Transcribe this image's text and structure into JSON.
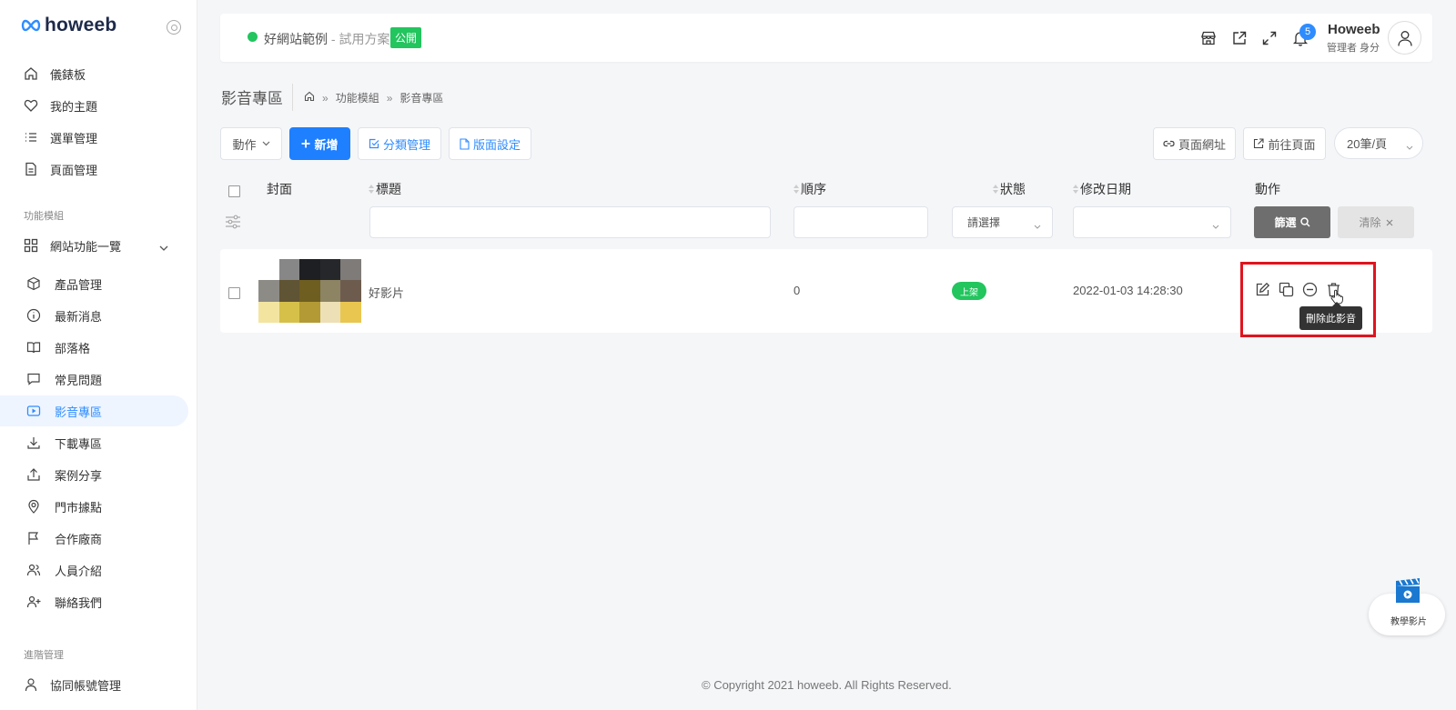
{
  "brand": {
    "name": "howeeb"
  },
  "sidebar": {
    "items": [
      {
        "label": "儀錶板",
        "icon": "home-icon"
      },
      {
        "label": "我的主題",
        "icon": "heart-icon"
      },
      {
        "label": "選單管理",
        "icon": "list-icon"
      },
      {
        "label": "頁面管理",
        "icon": "file-icon"
      }
    ],
    "section_modules": "功能模組",
    "group_label": "網站功能一覽",
    "modules": [
      {
        "label": "產品管理",
        "icon": "box-icon"
      },
      {
        "label": "最新消息",
        "icon": "info-icon"
      },
      {
        "label": "部落格",
        "icon": "book-icon"
      },
      {
        "label": "常見問題",
        "icon": "message-icon"
      },
      {
        "label": "影音專區",
        "icon": "video-icon"
      },
      {
        "label": "下載專區",
        "icon": "download-icon"
      },
      {
        "label": "案例分享",
        "icon": "share-icon"
      },
      {
        "label": "門市據點",
        "icon": "map-pin-icon"
      },
      {
        "label": "合作廠商",
        "icon": "flag-icon"
      },
      {
        "label": "人員介紹",
        "icon": "users-icon"
      },
      {
        "label": "聯絡我們",
        "icon": "user-plus-icon"
      }
    ],
    "section_admin": "進階管理",
    "admin_items": [
      {
        "label": "協同帳號管理",
        "icon": "user-icon"
      }
    ]
  },
  "topbar": {
    "site_name": "好網站範例",
    "site_plan": " - 試用方案",
    "site_badge": "公開",
    "notification_count": "5",
    "user_name": "Howeeb",
    "user_role": "管理者 身分"
  },
  "page": {
    "title": "影音專區",
    "breadcrumb": [
      "功能模組",
      "影音專區"
    ]
  },
  "toolbar": {
    "action_label": "動作",
    "add_label": "新增",
    "category_label": "分類管理",
    "layout_label": "版面設定",
    "page_url_label": "頁面網址",
    "goto_page_label": "前往頁面",
    "per_page": "20筆/頁"
  },
  "table": {
    "columns": {
      "cover": "封面",
      "title": "標題",
      "order": "順序",
      "status": "狀態",
      "modified": "修改日期",
      "actions": "動作"
    },
    "filter": {
      "status_placeholder": "請選擇",
      "filter_label": "篩選",
      "clear_label": "清除"
    },
    "rows": [
      {
        "title": "好影片",
        "order": "0",
        "status": "上架",
        "modified": "2022-01-03 14:28:30"
      }
    ],
    "tooltip": "刪除此影音"
  },
  "footer": {
    "copyright": "© Copyright 2021 howeeb. All Rights Reserved."
  },
  "help_widget": {
    "label": "教學影片"
  },
  "colors": {
    "accent": "#1e7fff",
    "success": "#22c55e",
    "highlight": "#e0141e"
  }
}
